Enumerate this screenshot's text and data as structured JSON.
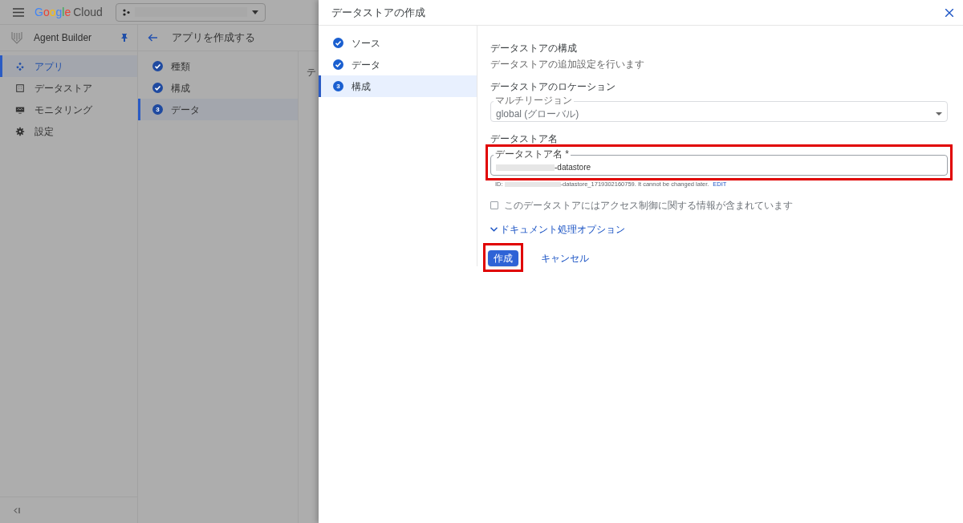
{
  "topbar": {
    "logo_text": "Google",
    "logo_suffix": "Cloud"
  },
  "sidebar": {
    "title": "Agent Builder",
    "items": [
      {
        "label": "アプリ",
        "selected": true
      },
      {
        "label": "データストア",
        "selected": false
      },
      {
        "label": "モニタリング",
        "selected": false
      },
      {
        "label": "設定",
        "selected": false
      }
    ]
  },
  "page": {
    "title": "アプリを作成する",
    "steps": [
      {
        "label": "種類",
        "done": true,
        "selected": false
      },
      {
        "label": "構成",
        "done": true,
        "selected": false
      },
      {
        "label": "データ",
        "done": false,
        "number": "3",
        "selected": true
      }
    ],
    "cut_heading": "テ"
  },
  "dialog": {
    "title": "データストアの作成",
    "steps": [
      {
        "label": "ソース",
        "done": true,
        "selected": false
      },
      {
        "label": "データ",
        "done": true,
        "selected": false
      },
      {
        "label": "構成",
        "done": false,
        "number": "3",
        "selected": true
      }
    ],
    "heading": "データストアの構成",
    "subheading": "データストアの追加設定を行います",
    "location": {
      "label": "データストアのロケーション",
      "field_label": "マルチリージョン",
      "value": "global (グローバル)",
      "disabled": true
    },
    "name": {
      "label": "データストア名",
      "field_label": "データストア名 *",
      "value": "-datastore",
      "highlighted": true,
      "id_prefix": "ID:",
      "id_suffix": "-datastore_1719302160759. It cannot be changed later.",
      "edit_link": "EDIT"
    },
    "checkbox": {
      "label": "このデータストアにはアクセス制御に関する情報が含まれています",
      "checked": false,
      "disabled": true
    },
    "expander": {
      "label": "ドキュメント処理オプション",
      "expanded": false
    },
    "buttons": [
      {
        "label": "作成",
        "kind": "primary",
        "highlighted": true
      },
      {
        "label": "キャンセル",
        "kind": "text"
      }
    ]
  }
}
